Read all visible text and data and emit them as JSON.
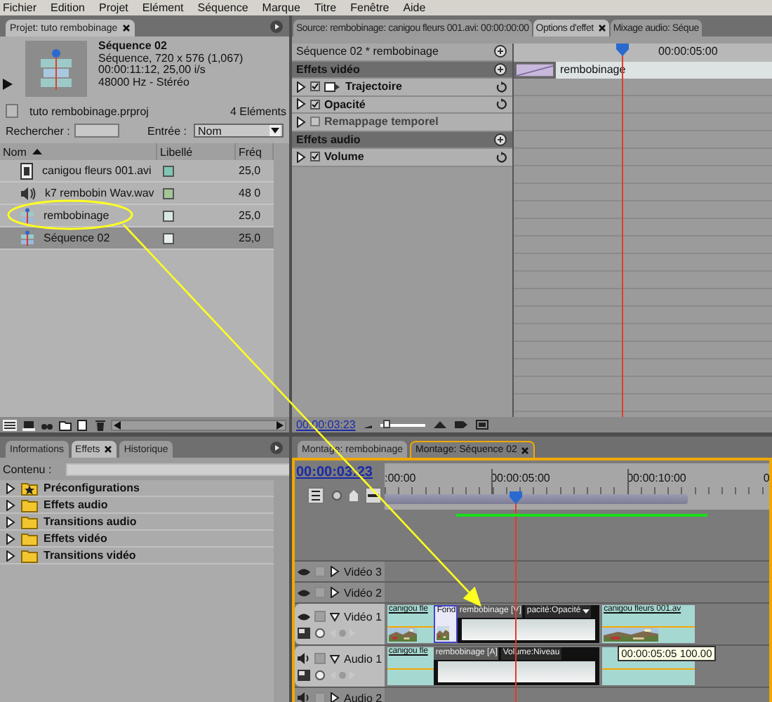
{
  "menu": [
    "Fichier",
    "Edition",
    "Projet",
    "Elément",
    "Séquence",
    "Marque",
    "Titre",
    "Fenêtre",
    "Aide"
  ],
  "project": {
    "tabs": [
      {
        "label": "Projet: tuto rembobinage",
        "selected": true
      }
    ],
    "sequence": {
      "name": "Séquence 02",
      "details": [
        "Séquence, 720 x 576 (1,067)",
        "00:00:11:12, 25,00 i/s",
        "48000 Hz - Stéréo"
      ]
    },
    "file": "tuto rembobinage.prproj",
    "count": "4 Eléments",
    "search": {
      "label": "Rechercher :"
    },
    "entry": {
      "label": "Entrée :",
      "value": "Nom"
    },
    "columns": [
      "Nom",
      "Libellé",
      "Fréq"
    ],
    "items": [
      {
        "name": "canigou fleurs 001.avi",
        "kind": "video",
        "color": "#7fc6b4",
        "rate": "25,0",
        "selected": false
      },
      {
        "name": "k7 rembobin Wav.wav",
        "kind": "audio",
        "color": "#a3c696",
        "rate": "48 0",
        "selected": false
      },
      {
        "name": "rembobinage",
        "kind": "sequence",
        "color": "#d8e8e6",
        "rate": "25,0",
        "selected": false
      },
      {
        "name": "Séquence 02",
        "kind": "sequence",
        "color": "#e8eeee",
        "rate": "25,0",
        "selected": true
      }
    ]
  },
  "effect_options": {
    "tabs": [
      {
        "label": "Source: rembobinage: canigou fleurs 001.avi: 00:00:00:00",
        "selected": false
      },
      {
        "label": "Options d'effet",
        "selected": true
      },
      {
        "label": "Mixage audio: Séque",
        "selected": false
      }
    ],
    "clip_header": "Séquence 02 * rembobinage",
    "ruler_time": "00:00:05:00",
    "clip_label": "rembobinage",
    "groups": [
      {
        "title": "Effets vidéo",
        "effects": [
          {
            "name": "Trajectoire",
            "kind": "motion",
            "enabled": true
          },
          {
            "name": "Opacité",
            "kind": "fixed",
            "enabled": true
          },
          {
            "name": "Remappage temporel",
            "kind": "fixed",
            "enabled": false
          }
        ]
      },
      {
        "title": "Effets audio",
        "effects": [
          {
            "name": "Volume",
            "kind": "fixed",
            "enabled": true
          }
        ]
      }
    ],
    "timecode": "00:00:03:23",
    "zoom": {
      "level": 0.12
    }
  },
  "effects_panel": {
    "tabs": [
      {
        "label": "Informations",
        "selected": false
      },
      {
        "label": "Effets",
        "selected": true
      },
      {
        "label": "Historique",
        "selected": false
      }
    ],
    "search_label": "Contenu :",
    "folders": [
      {
        "name": "Préconfigurations",
        "kind": "presets"
      },
      {
        "name": "Effets audio",
        "kind": "folder"
      },
      {
        "name": "Transitions audio",
        "kind": "folder"
      },
      {
        "name": "Effets vidéo",
        "kind": "folder"
      },
      {
        "name": "Transitions vidéo",
        "kind": "folder"
      }
    ]
  },
  "timeline": {
    "tabs": [
      {
        "label": "Montage: rembobinage",
        "selected": false
      },
      {
        "label": "Montage: Séquence 02",
        "selected": true
      }
    ],
    "timecode": "00:00:03:23",
    "ruler": [
      ":00:00",
      "00:00:05:00",
      "00:00:10:00",
      "0"
    ],
    "tracks": [
      {
        "name": "Vidéo 3",
        "kind": "video",
        "expanded": false
      },
      {
        "name": "Vidéo 2",
        "kind": "video",
        "expanded": false
      },
      {
        "name": "Vidéo 1",
        "kind": "video",
        "expanded": true,
        "clips": [
          {
            "kind": "media",
            "label": "canigou fle"
          },
          {
            "kind": "fond",
            "label": "Fond"
          },
          {
            "kind": "nested",
            "label": "rembobinage [V]",
            "effect": "pacité:Opacité"
          },
          {
            "kind": "media",
            "label": "canigou fleurs 001.av"
          }
        ]
      },
      {
        "name": "Audio 1",
        "kind": "audio",
        "expanded": true,
        "clips": [
          {
            "kind": "media",
            "label": "canigou fle"
          },
          {
            "kind": "nested",
            "label": "rembobinage [A]",
            "effect": "Volume:Niveau"
          },
          {
            "kind": "media"
          }
        ]
      },
      {
        "name": "Audio 2",
        "kind": "audio",
        "expanded": false
      }
    ],
    "tooltip": "00:00:05:05  100.00"
  }
}
